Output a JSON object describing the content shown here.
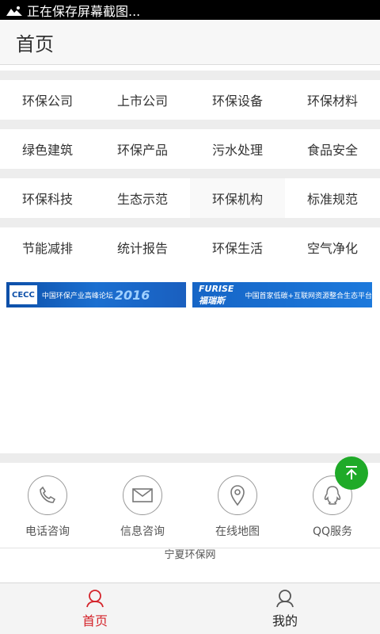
{
  "status_bar": {
    "text": "正在保存屏幕截图..."
  },
  "header": {
    "title": "首页"
  },
  "categories": [
    [
      "环保公司",
      "上市公司",
      "环保设备",
      "环保材料"
    ],
    [
      "绿色建筑",
      "环保产品",
      "污水处理",
      "食品安全"
    ],
    [
      "环保科技",
      "生态示范",
      "环保机构",
      "标准规范"
    ],
    [
      "节能减排",
      "统计报告",
      "环保生活",
      "空气净化"
    ]
  ],
  "banners": [
    {
      "logo": "CECC",
      "text": "中国环保产业高峰论坛",
      "year": "2016"
    },
    {
      "logo": "FURISE 福瑞斯",
      "text": "中国首家低碳+互联网资源整合生态平台"
    }
  ],
  "services": [
    {
      "label": "电话咨询",
      "icon": "phone-icon"
    },
    {
      "label": "信息咨询",
      "icon": "mail-icon"
    },
    {
      "label": "在线地图",
      "icon": "map-pin-icon"
    },
    {
      "label": "QQ服务",
      "icon": "qq-icon"
    }
  ],
  "footer": {
    "site_name": "宁夏环保网"
  },
  "tabbar": [
    {
      "label": "首页",
      "active": true
    },
    {
      "label": "我的",
      "active": false
    }
  ],
  "colors": {
    "accent_red": "#d4232a",
    "fab_green": "#1faa28",
    "banner_blue": "#0d4fa8"
  }
}
